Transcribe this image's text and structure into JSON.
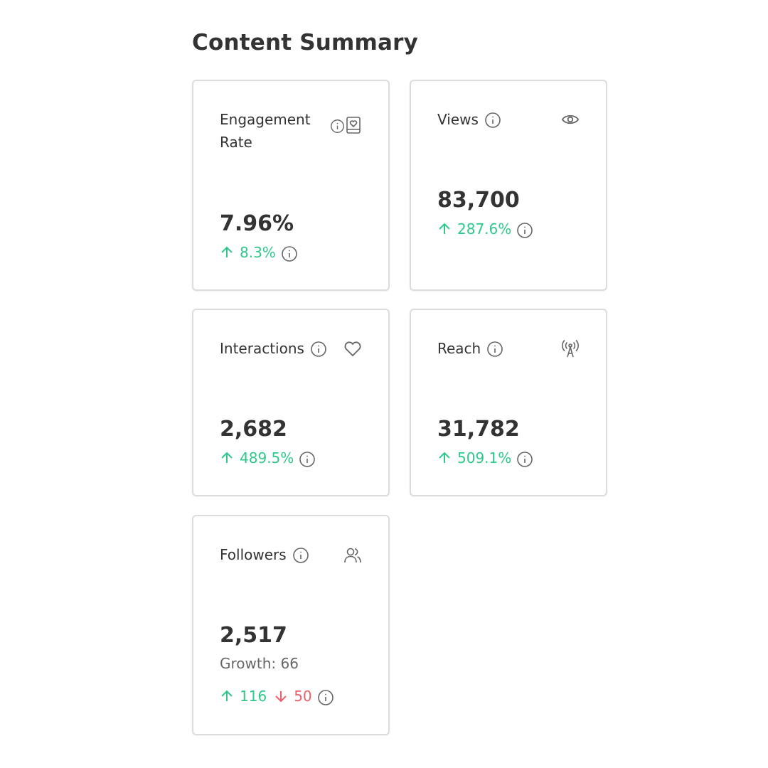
{
  "page_title": "Content Summary",
  "colors": {
    "up": "#2ec98a",
    "down": "#ee5f6b",
    "text": "#333333",
    "muted": "#666666",
    "icon": "#666666"
  },
  "cards": {
    "engagement": {
      "title": "Engagement Rate",
      "value": "7.96%",
      "change": "8.3%",
      "icon": "book-heart-icon"
    },
    "views": {
      "title": "Views",
      "value": "83,700",
      "change": "287.6%",
      "icon": "eye-icon"
    },
    "interactions": {
      "title": "Interactions",
      "value": "2,682",
      "change": "489.5%",
      "icon": "heart-icon"
    },
    "reach": {
      "title": "Reach",
      "value": "31,782",
      "change": "509.1%",
      "icon": "broadcast-icon"
    },
    "followers": {
      "title": "Followers",
      "value": "2,517",
      "growth": "Growth: 66",
      "gained": "116",
      "lost": "50",
      "icon": "users-icon"
    }
  }
}
